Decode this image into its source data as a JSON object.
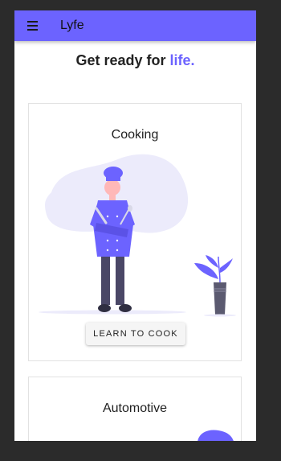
{
  "app": {
    "title": "Lyfe"
  },
  "header": {
    "headline_prefix": "Get ready for ",
    "headline_accent": "life."
  },
  "cards": [
    {
      "title": "Cooking",
      "button_label": "LEARN TO COOK",
      "illustration": "chef-illustration"
    },
    {
      "title": "Automotive",
      "illustration": "automotive-illustration"
    }
  ],
  "colors": {
    "accent": "#6c63ff",
    "background": "#2b2b2b",
    "surface": "#ffffff"
  },
  "icons": {
    "menu": "menu-icon"
  }
}
